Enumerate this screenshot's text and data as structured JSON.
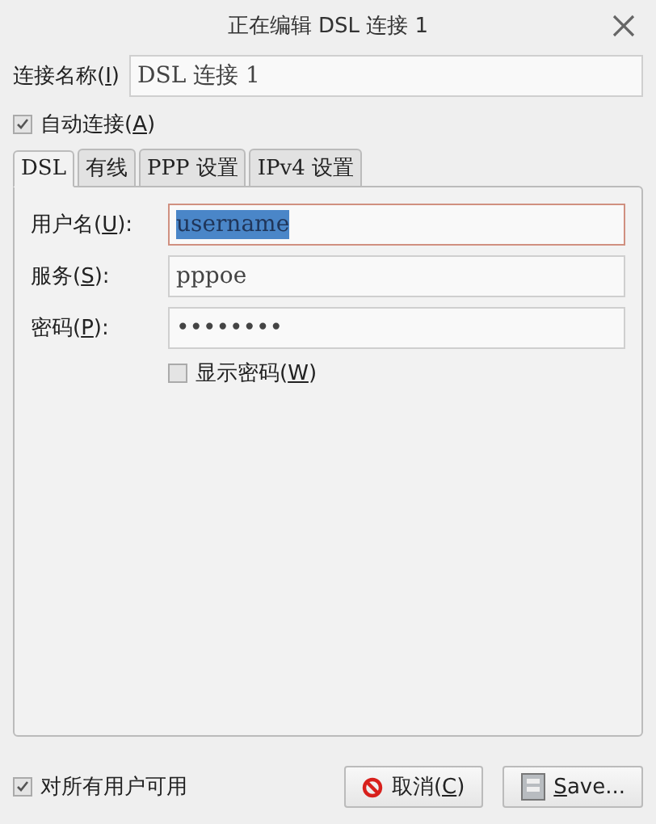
{
  "window": {
    "title": "正在编辑 DSL 连接 1"
  },
  "connection_name": {
    "label": {
      "before": "连接名称(",
      "key": "I",
      "after": ")"
    },
    "value": "DSL 连接 1"
  },
  "auto_connect": {
    "label": {
      "before": "自动连接(",
      "key": "A",
      "after": ")"
    },
    "checked": true
  },
  "tabs": [
    {
      "label": "DSL",
      "selected": true
    },
    {
      "label": "有线",
      "selected": false
    },
    {
      "label": "PPP 设置",
      "selected": false
    },
    {
      "label": "IPv4 设置",
      "selected": false
    }
  ],
  "fields": [
    {
      "label": {
        "before": "用户名(",
        "key": "U",
        "after": "):"
      },
      "value": "username",
      "focused": true,
      "text_selected": true
    },
    {
      "label": {
        "before": "服务(",
        "key": "S",
        "after": "):"
      },
      "value": "pppoe",
      "focused": false,
      "text_selected": false
    },
    {
      "label": {
        "before": "密码(",
        "key": "P",
        "after": "):"
      },
      "value": "••••••••",
      "focused": false,
      "text_selected": false
    }
  ],
  "show_password": {
    "label": {
      "before": "显示密码(",
      "key": "W",
      "after": ")"
    },
    "checked": false
  },
  "all_users": {
    "label": "对所有用户可用",
    "checked": true
  },
  "buttons": [
    {
      "kind": "cancel",
      "label": {
        "before": "取消(",
        "key": "C",
        "after": ")"
      }
    },
    {
      "kind": "save",
      "label": {
        "key": "S",
        "after": "ave..."
      }
    }
  ]
}
